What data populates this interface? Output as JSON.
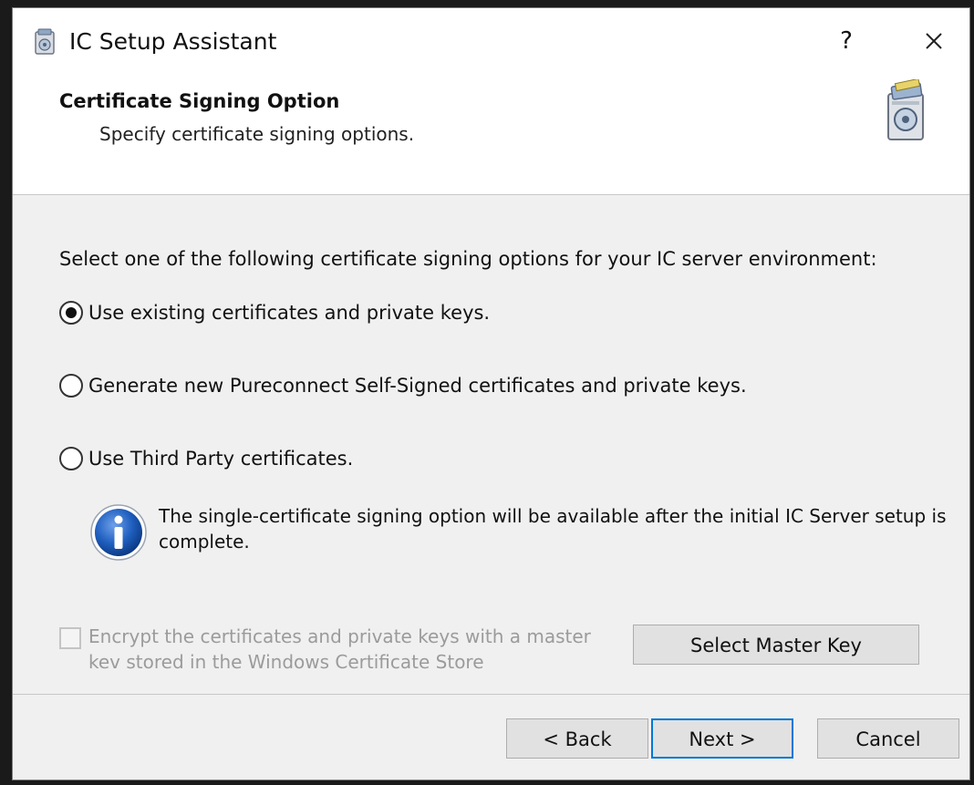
{
  "window": {
    "title": "IC Setup Assistant",
    "help_label": "?"
  },
  "header": {
    "title": "Certificate Signing Option",
    "subtitle": "Specify certificate signing options."
  },
  "content": {
    "instruction": "Select one of the following certificate signing options for your IC server environment:",
    "options": [
      {
        "label": "Use existing certificates and private keys.",
        "selected": true
      },
      {
        "label": "Generate new Pureconnect Self-Signed certificates and private keys.",
        "selected": false
      },
      {
        "label": "Use Third Party certificates.",
        "selected": false
      }
    ],
    "info_text": "The single-certificate signing option will be available after the initial IC Server setup is complete.",
    "encrypt": {
      "label": "Encrypt the certificates and private keys with a master kev stored in the Windows Certificate Store",
      "checked": false,
      "enabled": false
    },
    "master_key_button": "Select Master Key"
  },
  "footer": {
    "back_label": "< Back",
    "next_label": "Next >",
    "cancel_label": "Cancel"
  },
  "colors": {
    "accent": "#0078d7",
    "info_blue": "#1f5fbf",
    "disabled_text": "#9b9b9b"
  },
  "icons": {
    "app": "setup-icon",
    "header": "setup-box-icon",
    "info": "info-icon",
    "close": "close-icon"
  }
}
